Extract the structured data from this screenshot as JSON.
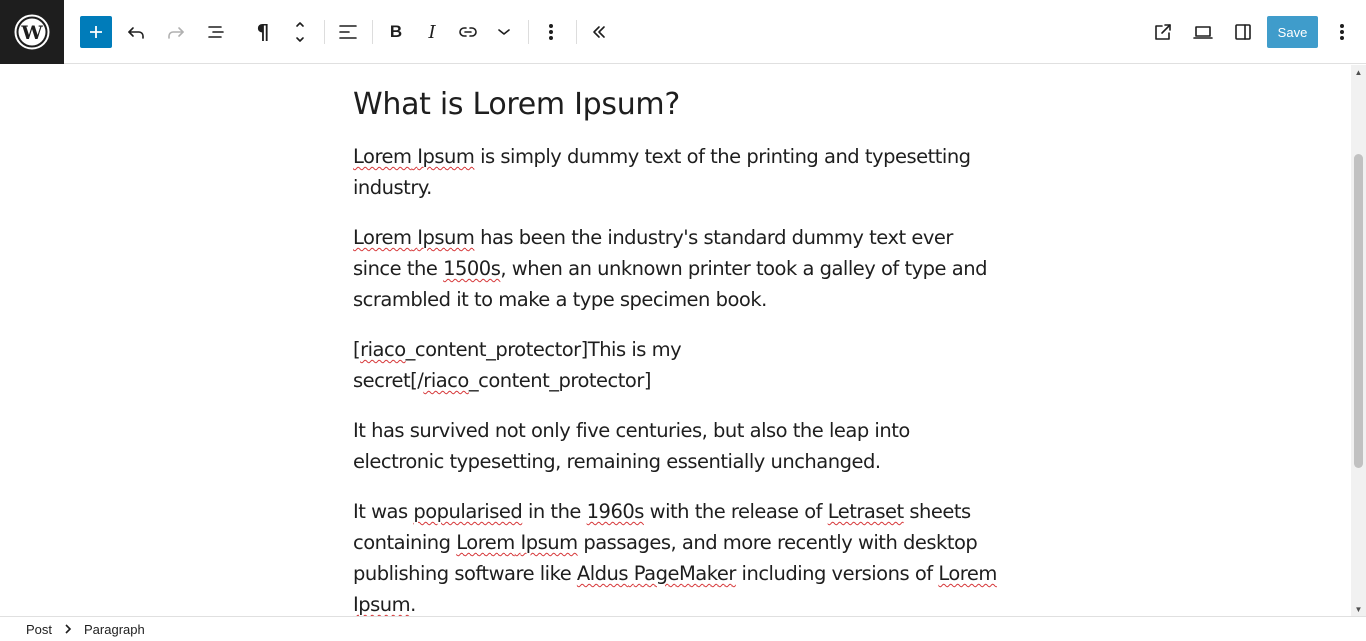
{
  "toolbar": {
    "logo_icon": "wordpress-icon",
    "inserter_icon": "plus-icon",
    "undo_icon": "undo-icon",
    "redo_icon": "redo-icon",
    "list_view_icon": "list-view-icon",
    "paragraph_icon": "pilcrow-icon",
    "paragraph_glyph": "¶",
    "move_icon": "up-down-arrows-icon",
    "align_icon": "align-left-icon",
    "bold_label": "B",
    "italic_label": "I",
    "link_icon": "link-icon",
    "more_formats_icon": "chevron-down-icon",
    "options_icon": "vertical-ellipsis-icon",
    "collapse_icon": "double-chevron-left-icon",
    "view_post_icon": "external-link-icon",
    "preview_icon": "laptop-icon",
    "settings_icon": "sidebar-toggle-icon",
    "save_label": "Save",
    "main_options_icon": "vertical-ellipsis-icon",
    "accent_color": "#007cba"
  },
  "editor": {
    "heading": "What is Lorem Ipsum?",
    "p1": {
      "a": "Lorem",
      "b": " ",
      "c": "Ipsum",
      "d": " is simply dummy text of the printing and typesetting industry."
    },
    "p2": {
      "a": "Lorem",
      "b": " ",
      "c": "Ipsum",
      "d": " has been the industry's standard dummy text ever since the ",
      "e": "1500s",
      "f": ", when an unknown printer took a galley of type and scrambled it to make a type specimen book."
    },
    "p3": {
      "a": "[",
      "b": "riaco",
      "c": "_content_protector]This is my secret[/",
      "d": "riaco",
      "e": "_content_protector]"
    },
    "p4": "It has survived not only five centuries, but also the leap into electronic typesetting, remaining essentially unchanged.",
    "p5": {
      "a": "It was ",
      "b": "popularised",
      "c": " in the ",
      "d": "1960s",
      "e": " with the release of ",
      "f": "Letraset",
      "g": " sheets containing ",
      "h": "Lorem",
      "i": " ",
      "j": "Ipsum",
      "k": " passages, and more recently with desktop publishing software like ",
      "l": "Aldus",
      "m": " ",
      "n": "PageMaker",
      "o": " including versions of ",
      "p": "Lorem",
      "q": " ",
      "r": "Ipsum",
      "s": "."
    },
    "spellcheck_color": "#d63638"
  },
  "footer": {
    "crumb_post": "Post",
    "crumb_separator_icon": "chevron-right-icon",
    "crumb_block": "Paragraph"
  }
}
